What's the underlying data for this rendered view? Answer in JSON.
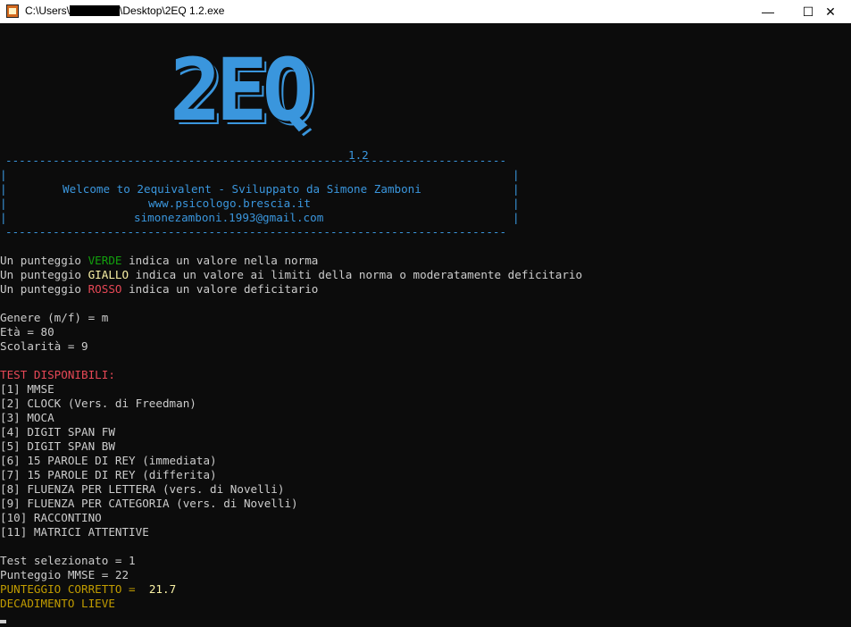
{
  "window": {
    "title_prefix": "C:\\Users\\",
    "title_suffix": "\\Desktop\\2EQ 1.2.exe",
    "minimize": "—",
    "maximize": "☐",
    "close": "✕"
  },
  "logo": {
    "text": "2EQ",
    "version": "1.2"
  },
  "banner": {
    "rule": "--------------------------------------------------------------------------",
    "welcome": "Welcome to 2equivalent - Sviluppato da Simone Zamboni",
    "website": "www.psicologo.brescia.it",
    "email": "simonezamboni.1993@gmail.com"
  },
  "legend": {
    "prefix": "Un punteggio ",
    "green_word": "VERDE",
    "green_rest": " indica un valore nella norma",
    "yellow_word": "GIALLO",
    "yellow_rest": " indica un valore ai limiti della norma o moderatamente deficitario",
    "red_word": "ROSSO",
    "red_rest": " indica un valore deficitario"
  },
  "patient": {
    "genere": "Genere (m/f) = m",
    "eta": "Età = 80",
    "scolarita": "Scolarità = 9"
  },
  "tests": {
    "header": "TEST DISPONIBILI:",
    "items": [
      "[1] MMSE",
      "[2] CLOCK (Vers. di Freedman)",
      "[3] MOCA",
      "[4] DIGIT SPAN FW",
      "[5] DIGIT SPAN BW",
      "[6] 15 PAROLE DI REY (immediata)",
      "[7] 15 PAROLE DI REY (differita)",
      "[8] FLUENZA PER LETTERA (vers. di Novelli)",
      "[9] FLUENZA PER CATEGORIA (vers. di Novelli)",
      "[10] RACCONTINO",
      "[11] MATRICI ATTENTIVE"
    ]
  },
  "result": {
    "selected": "Test selezionato = 1",
    "score": "Punteggio MMSE = 22",
    "corrected_label": "PUNTEGGIO CORRETTO = ",
    "corrected_value": " 21.7",
    "verdict": "DECADIMENTO LIEVE"
  },
  "colors": {
    "background": "#0c0c0c",
    "text": "#cccccc",
    "blue": "#3a96dd",
    "green": "#13a10e",
    "yellow": "#f9f1a5",
    "red": "#e74856",
    "orange": "#c19c00"
  }
}
